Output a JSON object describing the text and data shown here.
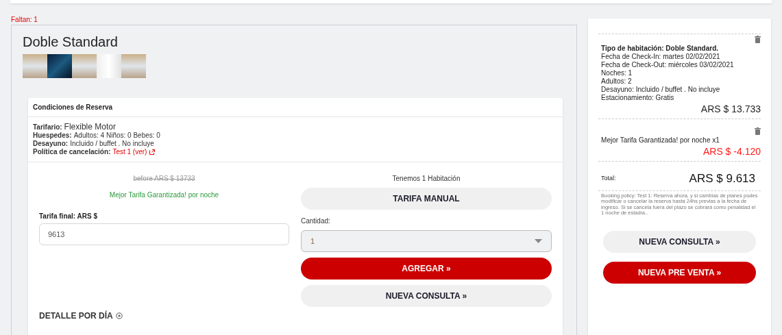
{
  "missing_label": "Faltan: 1",
  "room": {
    "title": "Doble Standard",
    "photos": [
      {
        "kind": "room"
      },
      {
        "kind": "city"
      },
      {
        "kind": "room"
      },
      {
        "kind": "abstract"
      },
      {
        "kind": "room"
      }
    ]
  },
  "conditions": {
    "title": "Condiciones de Reserva",
    "rows": [
      {
        "label": "Tarifario:",
        "value": "Flexible Motor",
        "kind": "large"
      },
      {
        "label": "Huespedes:",
        "value": "Adultos: 4 Niños: 0 Bebes: 0",
        "kind": "text"
      },
      {
        "label": "Desayuno:",
        "value": "Incluido / buffet . No incluye",
        "kind": "text"
      },
      {
        "label": "Política de cancelación:",
        "value": "Test 1 (ver)",
        "kind": "link"
      }
    ]
  },
  "offer": {
    "before": "before ARS $ 13733",
    "promo": "Mejor Tarifa Garantizada! por noche",
    "fare_label": "Tarifa final: ARS $",
    "fare_value": "9613",
    "availability": "Tenemos 1 Habitación",
    "quantity_label": "Cantidad:",
    "quantity_value": "1",
    "top_button": {
      "label": "TARIFA MANUAL",
      "kind": "secondary"
    },
    "buttons": [
      {
        "label": "AGREGAR »",
        "kind": "primary"
      },
      {
        "label": "NUEVA CONSULTA »",
        "kind": "secondary"
      }
    ],
    "detail": "DETALLE POR DÍA"
  },
  "summary": {
    "items": [
      {
        "title": "Tipo de habitación: Doble Standard.",
        "lines": [
          "Fecha de Check-In: martes 02/02/2021",
          "Fecha de Check-Out: miércoles 03/02/2021",
          "Noches: 1",
          "Adultos: 2",
          "Desayuno: Incluido / buffet . No incluye",
          "Estacionamiento: Gratis"
        ],
        "amount": "ARS $ 13.733",
        "negative": false
      },
      {
        "lines": [
          "Mejor Tarifa Garantizada! por noche x1"
        ],
        "amount": "ARS $ -4.120",
        "negative": true
      }
    ],
    "total_label": "Total:",
    "total": "ARS $ 9.613",
    "policy": "Booking policy: Test 1: Reserva ahora, y si cambias de planes podes modificar o cancelar la reserva hasta 24hs previas a la fecha de ingreso. Si se cancela fuera del plazo se cobrará como penalidad el 1 noche de estadía..",
    "buttons": [
      {
        "label": "NUEVA CONSULTA »",
        "kind": "secondary"
      },
      {
        "label": "NUEVA PRE VENTA »",
        "kind": "primary"
      }
    ]
  }
}
